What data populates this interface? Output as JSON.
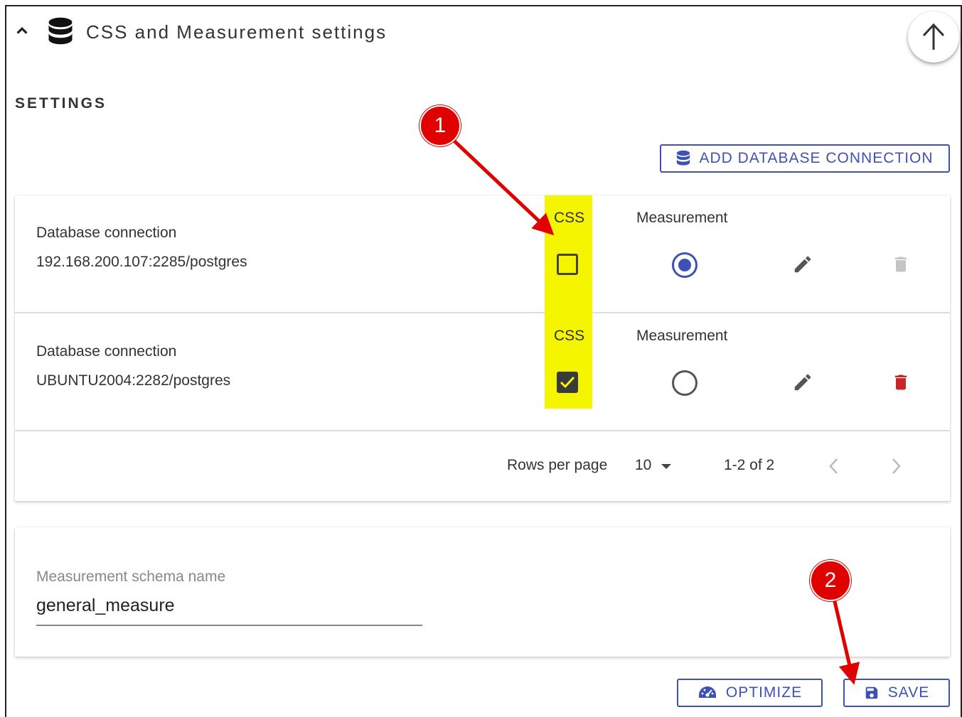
{
  "header": {
    "title": "CSS and Measurement settings",
    "collapse_icon": "chevron-up-icon",
    "db_icon": "database-icon",
    "scroll_top_icon": "arrow-up-icon"
  },
  "settings": {
    "title": "SETTINGS",
    "add_button": "ADD DATABASE CONNECTION"
  },
  "connections": {
    "col_css": "CSS",
    "col_measurement": "Measurement",
    "rows": [
      {
        "label": "Database connection",
        "value": "192.168.200.107:2285/postgres",
        "css_checked": false,
        "measurement_selected": true,
        "delete_enabled": false
      },
      {
        "label": "Database connection",
        "value": "UBUNTU2004:2282/postgres",
        "css_checked": true,
        "measurement_selected": false,
        "delete_enabled": true
      }
    ]
  },
  "pagination": {
    "rows_per_page_label": "Rows per page",
    "rows_per_page_value": "10",
    "range": "1-2 of 2"
  },
  "schema": {
    "label": "Measurement schema name",
    "value": "general_measure"
  },
  "actions": {
    "optimize": "OPTIMIZE",
    "save": "SAVE"
  },
  "annotations": {
    "badge1": "1",
    "badge2": "2"
  },
  "colors": {
    "primary": "#3f51b5",
    "highlight": "#f5f500",
    "annotation_red": "#e00000",
    "delete_red": "#c62828"
  }
}
